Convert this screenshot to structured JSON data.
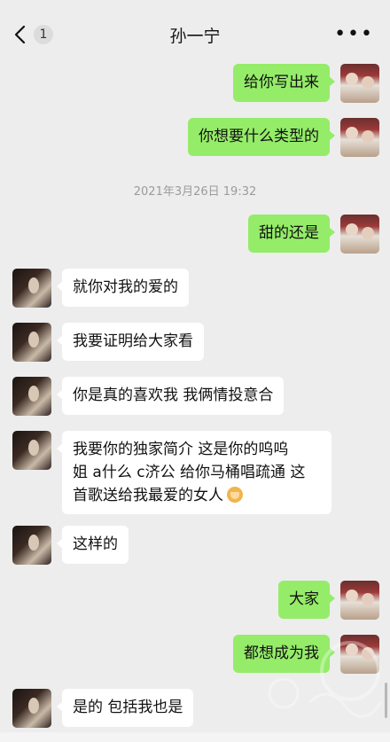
{
  "header": {
    "title": "孙一宁",
    "unread_count": "1",
    "more": "•••"
  },
  "timestamp": "2021年3月26日 19:32",
  "messages": [
    {
      "side": "me",
      "text": "给你写出来"
    },
    {
      "side": "me",
      "text": "你想要什么类型的"
    },
    {
      "side": "me",
      "text": "甜的还是"
    },
    {
      "side": "other",
      "text": "就你对我的爱的"
    },
    {
      "side": "other",
      "text": "我要证明给大家看"
    },
    {
      "side": "other",
      "text": "你是真的喜欢我 我俩情投意合"
    },
    {
      "side": "other",
      "lines": [
        "我要你的独家简介 这是你的呜呜",
        "姐 a什么 c济公 给你马桶唱疏通 这",
        "首歌送给我最爱的女人"
      ],
      "emoji": "woman-emoji"
    },
    {
      "side": "other",
      "text": "这样的"
    },
    {
      "side": "me",
      "text": "大家"
    },
    {
      "side": "me",
      "text": "都想成为我"
    },
    {
      "side": "other",
      "text": "是的 包括我也是"
    }
  ]
}
